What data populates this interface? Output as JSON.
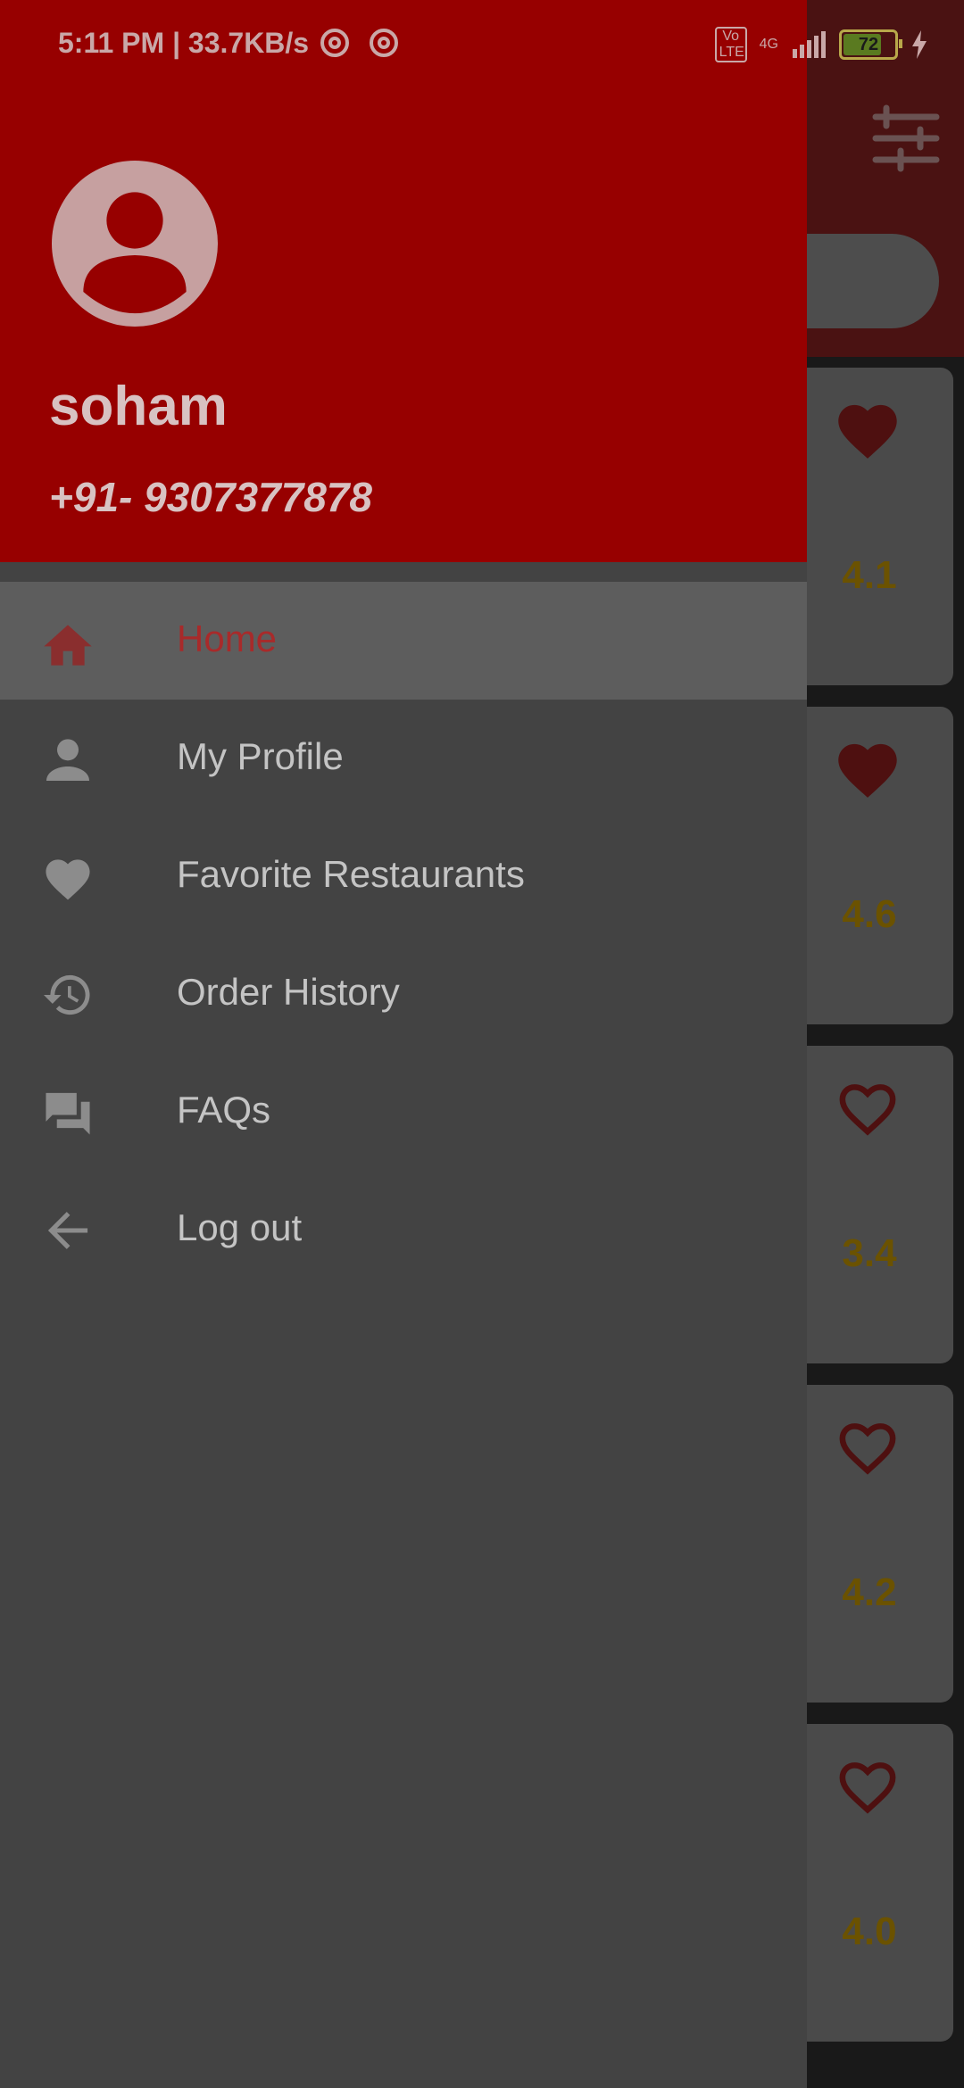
{
  "status_bar": {
    "time_speed": "5:11 PM | 33.7KB/s",
    "network_badge": "Vo LTE",
    "network_type": "4G",
    "battery_level": "72"
  },
  "drawer": {
    "user_name": "soham",
    "user_phone": "+91- 9307377878",
    "menu": [
      {
        "label": "Home",
        "icon": "home-icon",
        "active": true
      },
      {
        "label": "My Profile",
        "icon": "person-icon"
      },
      {
        "label": "Favorite Restaurants",
        "icon": "heart-icon"
      },
      {
        "label": "Order History",
        "icon": "history-icon"
      },
      {
        "label": "FAQs",
        "icon": "forum-icon"
      },
      {
        "label": "Log out",
        "icon": "arrow-back-icon"
      }
    ]
  },
  "background_list": {
    "ratings": [
      "4.1",
      "4.6",
      "3.4",
      "4.2",
      "4.0"
    ],
    "favorites": [
      true,
      true,
      false,
      false,
      false
    ]
  },
  "colors": {
    "header_red": "#970000",
    "accent_red": "#a82a2a",
    "drawer_bg": "#434343",
    "rating_gold": "#6b5200"
  }
}
